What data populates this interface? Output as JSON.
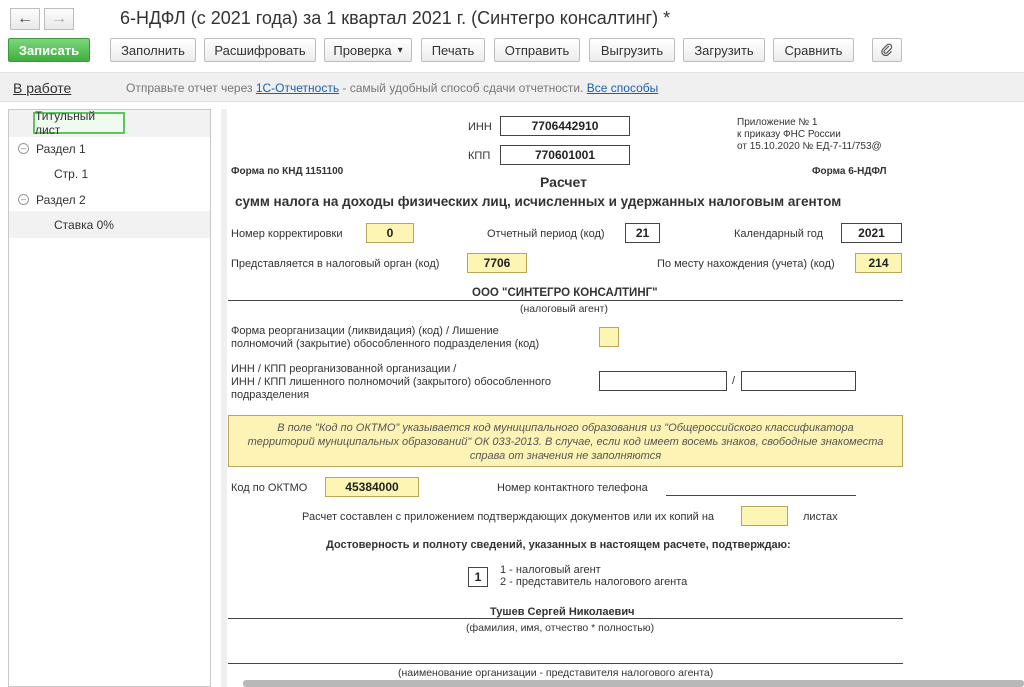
{
  "window": {
    "title": "6-НДФЛ (с 2021 года) за 1 квартал 2021 г. (Синтегро консалтинг) *",
    "back_icon": "←",
    "forward_icon": "→"
  },
  "toolbar": {
    "save": "Записать",
    "fill": "Заполнить",
    "decode": "Расшифровать",
    "check": "Проверка",
    "check_arrow": "▾",
    "print": "Печать",
    "send": "Отправить",
    "export": "Выгрузить",
    "import": "Загрузить",
    "compare": "Сравнить",
    "attach_icon": "📎"
  },
  "status": {
    "state": "В работе",
    "msg_pre": "Отправьте отчет через ",
    "msg_link1": "1С-Отчетность",
    "msg_mid": " - самый удобный способ сдачи отчетности. ",
    "msg_link2": "Все способы"
  },
  "tree": {
    "title_sheet": "Титульный лист",
    "section1": "Раздел 1",
    "page1": "Стр. 1",
    "section2": "Раздел 2",
    "rate0": "Ставка 0%",
    "collapse_glyph": "–"
  },
  "form": {
    "inn_label": "ИНН",
    "inn": "7706442910",
    "kpp_label": "КПП",
    "kpp": "770601001",
    "appendix1": "Приложение № 1",
    "appendix2": "к приказу ФНС России",
    "appendix3": "от 15.10.2020 № ЕД-7-11/753@",
    "knd": "Форма по КНД 1151100",
    "form_name": "Форма 6-НДФЛ",
    "heading1": "Расчет",
    "heading2": "сумм налога на доходы физических лиц, исчисленных и удержанных налоговым агентом",
    "corr_label": "Номер корректировки",
    "corr": "0",
    "period_label": "Отчетный период (код)",
    "period": "21",
    "year_label": "Календарный год",
    "year": "2021",
    "tax_org_label": "Представляется в налоговый орган (код)",
    "tax_org": "7706",
    "location_label": "По месту нахождения (учета) (код)",
    "location": "214",
    "org_name": "ООО \"СИНТЕГРО КОНСАЛТИНГ\"",
    "org_caption": "(налоговый агент)",
    "reorg_label1": "Форма реорганизации (ликвидация) (код) / Лишение",
    "reorg_label2": "полномочий (закрытие) обособленного подразделения (код)",
    "reorg_inn_label1": "ИНН / КПП реорганизованной организации /",
    "reorg_inn_label2": "ИНН / КПП лишенного полномочий (закрытого) обособленного",
    "reorg_inn_label3": "подразделения",
    "slash": "/",
    "notice1": "В поле \"Код по ОКТМО\" указывается код муниципального образования из \"Общероссийского классификатора",
    "notice2": "территорий муниципальных образований\" ОК 033-2013. В случае, если код имеет восемь знаков, свободные знакоместа",
    "notice3": "справа от значения не заполняются",
    "oktmo_label": "Код по ОКТМО",
    "oktmo": "45384000",
    "phone_label": "Номер контактного телефона",
    "attach_label": "Расчет составлен с приложением подтверждающих документов или их копий на",
    "sheets_label": "листах",
    "confirm": "Достоверность и полноту сведений, указанных в настоящем расчете, подтверждаю:",
    "signer_code": "1",
    "signer_opt1": "1 - налоговый агент",
    "signer_opt2": "2 - представитель налогового агента",
    "signer_name": "Тушев Сергей Николаевич",
    "signer_caption": "(фамилия, имя, отчество * полностью)",
    "rep_caption": "(наименование организации - представителя налогового агента)"
  }
}
